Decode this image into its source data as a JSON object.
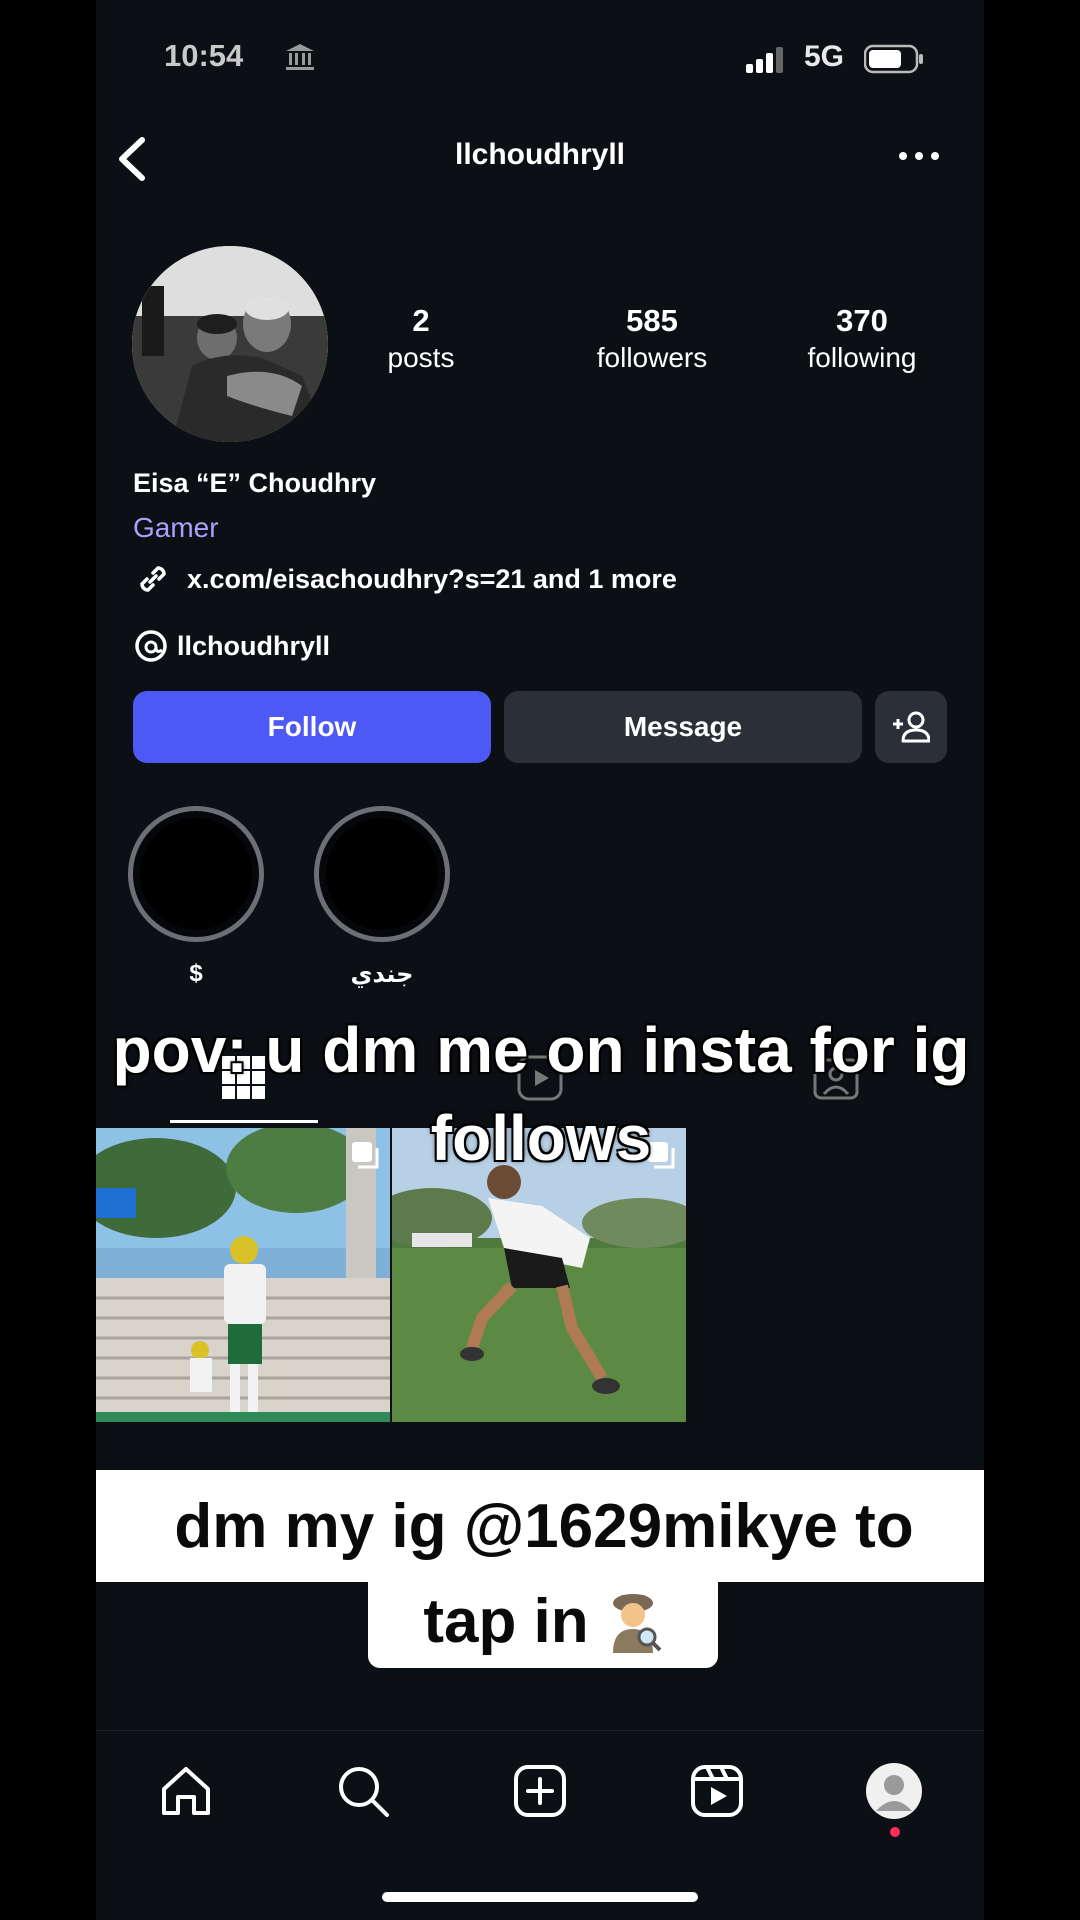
{
  "status_bar": {
    "time": "10:54",
    "network": "5G"
  },
  "header": {
    "username": "llchoudhryll"
  },
  "profile": {
    "stats": [
      {
        "value": "2",
        "label": "posts"
      },
      {
        "value": "585",
        "label": "followers"
      },
      {
        "value": "370",
        "label": "following"
      }
    ],
    "full_name": "Eisa “E” Choudhry",
    "category": "Gamer",
    "link_text": "x.com/eisachoudhry?s=21 and 1 more",
    "threads_handle": "llchoudhryll"
  },
  "actions": {
    "follow_label": "Follow",
    "message_label": "Message"
  },
  "highlights": [
    {
      "label": "$"
    },
    {
      "label": "جندي"
    }
  ],
  "overlay": {
    "caption_top": "pov: u dm me on insta for ig follows",
    "caption_bottom_line1": "dm my ig @1629mikye to",
    "caption_bottom_line2": "tap in"
  },
  "icons": {
    "back": "chevron-left-icon",
    "more": "ellipsis-icon",
    "link": "link-icon",
    "threads": "threads-icon",
    "add_person": "add-person-icon",
    "tabs": [
      "grid-icon",
      "reels-icon",
      "tagged-icon"
    ],
    "nav": [
      "home-icon",
      "search-icon",
      "create-icon",
      "reels-icon",
      "profile-avatar"
    ]
  },
  "colors": {
    "accent": "#4c59f5",
    "category": "#a6a3ff",
    "background": "#0c0f14",
    "notification_dot": "#ff2d55"
  }
}
